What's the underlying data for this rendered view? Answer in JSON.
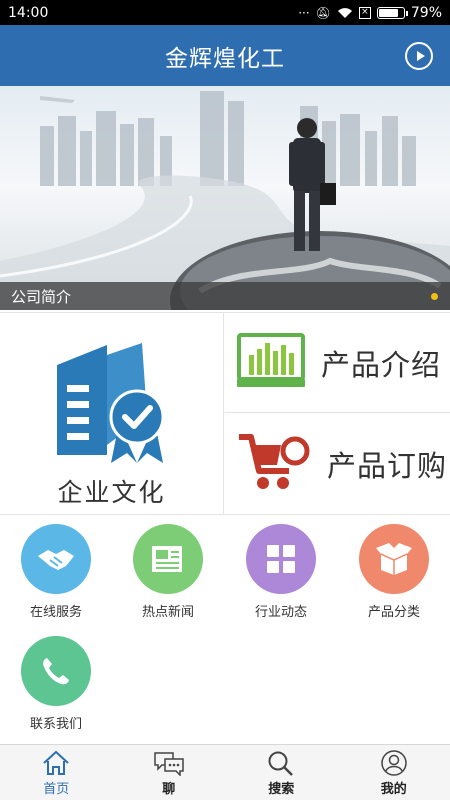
{
  "status_bar": {
    "time": "14:00",
    "battery": "79%",
    "battery_level": 0.79
  },
  "header": {
    "title": "金辉煌化工"
  },
  "banner": {
    "caption": "公司简介"
  },
  "tiles": {
    "culture": "企业文化",
    "product_intro": "产品介绍",
    "product_order": "产品订购"
  },
  "services": [
    {
      "label": "在线服务",
      "icon": "handshake-icon",
      "color": "#5bb8e6"
    },
    {
      "label": "热点新闻",
      "icon": "newspaper-icon",
      "color": "#7ccd76"
    },
    {
      "label": "行业动态",
      "icon": "grid-icon",
      "color": "#ad88d8"
    },
    {
      "label": "产品分类",
      "icon": "box-icon",
      "color": "#f0886b"
    },
    {
      "label": "联系我们",
      "icon": "phone-icon",
      "color": "#5cc591"
    }
  ],
  "tabs": [
    {
      "label": "首页",
      "icon": "home-icon",
      "active": true
    },
    {
      "label": "聊",
      "icon": "chat-icon",
      "active": false
    },
    {
      "label": "搜索",
      "icon": "search-icon",
      "active": false
    },
    {
      "label": "我的",
      "icon": "profile-icon",
      "active": false
    }
  ],
  "colors": {
    "primary": "#2e6db0",
    "accent_red": "#c0392b",
    "accent_green": "#5fb34a"
  }
}
